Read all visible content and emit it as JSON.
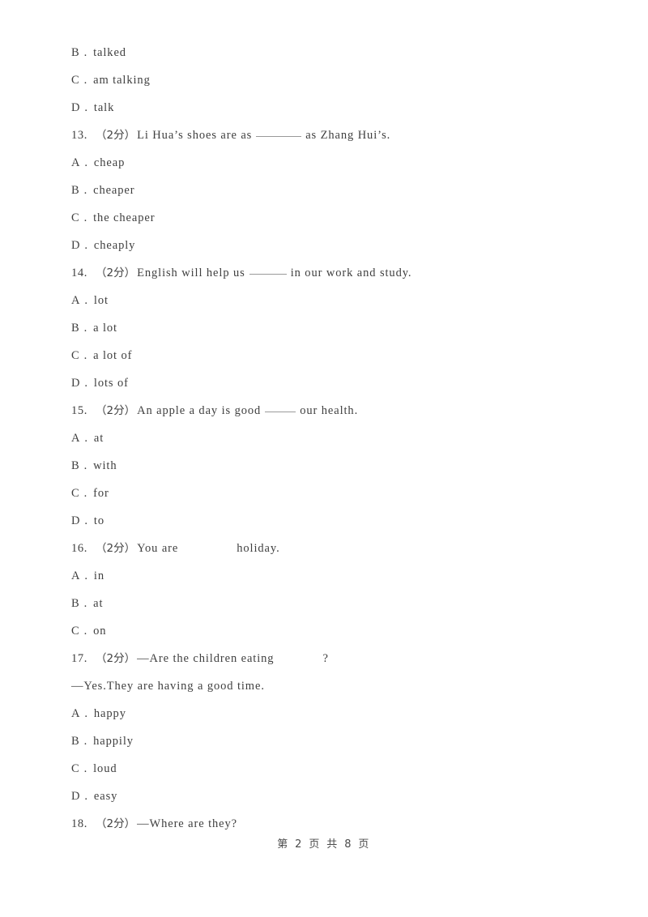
{
  "document": {
    "footer": "第 2 页 共 8 页"
  },
  "lines": [
    {
      "kind": "option",
      "letter": "B",
      "sep": ".",
      "text": "talked"
    },
    {
      "kind": "option",
      "letter": "C",
      "sep": ".",
      "text": "am talking"
    },
    {
      "kind": "option",
      "letter": "D",
      "sep": ".",
      "text": "talk"
    },
    {
      "kind": "question",
      "number": "13.",
      "marks": "（2分）",
      "before": "Li Hua’s shoes are as",
      "blank": "underline-long",
      "after": "as Zhang Hui’s."
    },
    {
      "kind": "option",
      "letter": "A",
      "sep": ".",
      "text": "cheap"
    },
    {
      "kind": "option",
      "letter": "B",
      "sep": ".",
      "text": "cheaper"
    },
    {
      "kind": "option",
      "letter": "C",
      "sep": ".",
      "text": "the cheaper"
    },
    {
      "kind": "option",
      "letter": "D",
      "sep": ".",
      "text": "cheaply"
    },
    {
      "kind": "question",
      "number": "14.",
      "marks": "（2分）",
      "before": "English will help us",
      "blank": "underline-mid",
      "after": "in our work and study."
    },
    {
      "kind": "option",
      "letter": "A",
      "sep": ".",
      "text": "lot"
    },
    {
      "kind": "option",
      "letter": "B",
      "sep": ".",
      "text": "a lot"
    },
    {
      "kind": "option",
      "letter": "C",
      "sep": ".",
      "text": "a lot of"
    },
    {
      "kind": "option",
      "letter": "D",
      "sep": ".",
      "text": "lots of"
    },
    {
      "kind": "question",
      "number": "15.",
      "marks": "（2分）",
      "before": "An apple a day is good",
      "blank": "underline-short",
      "after": "our health."
    },
    {
      "kind": "option",
      "letter": "A",
      "sep": ".",
      "text": "at"
    },
    {
      "kind": "option",
      "letter": "B",
      "sep": ".",
      "text": "with"
    },
    {
      "kind": "option",
      "letter": "C",
      "sep": ".",
      "text": "for"
    },
    {
      "kind": "option",
      "letter": "D",
      "sep": ".",
      "text": "to"
    },
    {
      "kind": "question",
      "number": "16.",
      "marks": "（2分）",
      "before": "You are",
      "blank": "gap-wide",
      "after": "holiday."
    },
    {
      "kind": "option",
      "letter": "A",
      "sep": ".",
      "text": "in"
    },
    {
      "kind": "option",
      "letter": "B",
      "sep": ".",
      "text": "at"
    },
    {
      "kind": "option",
      "letter": "C",
      "sep": ".",
      "text": "on"
    },
    {
      "kind": "question",
      "number": "17.",
      "marks": "（2分）",
      "before": "—Are the children eating",
      "blank": "gap-med",
      "after": "?"
    },
    {
      "kind": "plain",
      "text": "—Yes.They are having a good time."
    },
    {
      "kind": "option",
      "letter": "A",
      "sep": ".",
      "text": "happy"
    },
    {
      "kind": "option",
      "letter": "B",
      "sep": ".",
      "text": "happily"
    },
    {
      "kind": "option",
      "letter": "C",
      "sep": ".",
      "text": "loud"
    },
    {
      "kind": "option",
      "letter": "D",
      "sep": ".",
      "text": "easy"
    },
    {
      "kind": "question",
      "number": "18.",
      "marks": "（2分）",
      "before": "—Where are they?",
      "blank": "none",
      "after": ""
    }
  ]
}
